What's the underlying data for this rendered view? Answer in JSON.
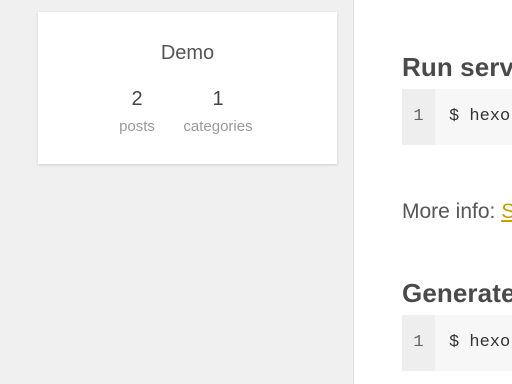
{
  "profile": {
    "name": "Demo",
    "stats": [
      {
        "value": "2",
        "label": "posts"
      },
      {
        "value": "1",
        "label": "categories"
      }
    ]
  },
  "content": {
    "headings": [
      "Run serve",
      "Generate"
    ],
    "code_blocks": [
      {
        "line": "1",
        "text": "$ hexo"
      },
      {
        "line": "1",
        "text": "$ hexo"
      }
    ],
    "more_info": {
      "label": "More info: ",
      "link_text": "S"
    }
  },
  "colors": {
    "background": "#efefef",
    "card": "#ffffff",
    "heading": "#4a4a4a",
    "text": "#555555",
    "muted": "#9a9a9a",
    "code_background": "#f7f7f7",
    "link_accent": "#c0a000"
  }
}
